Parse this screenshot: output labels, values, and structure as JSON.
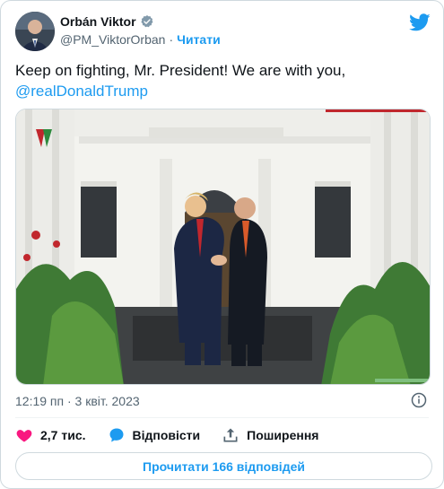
{
  "author": {
    "name": "Orbán Viktor",
    "handle": "@PM_ViktorOrban",
    "separator": "·",
    "follow_label": "Читати",
    "avatar_icon": "person-avatar",
    "verified_icon": "verified-badge-icon"
  },
  "tweet": {
    "text": "Keep on fighting, Mr. President! We are with you,",
    "mention": "@realDonaldTrump",
    "timestamp": "12:19 пп · 3 квіт. 2023"
  },
  "actions": {
    "likes_count": "2,7 тис.",
    "reply_label": "Відповісти",
    "share_label": "Поширення"
  },
  "read_replies_label": "Прочитати 166 відповідей",
  "colors": {
    "accent": "#1d9bf0",
    "like": "#f91880",
    "text": "#0f1419",
    "muted": "#536471",
    "border": "#cfd9de"
  }
}
